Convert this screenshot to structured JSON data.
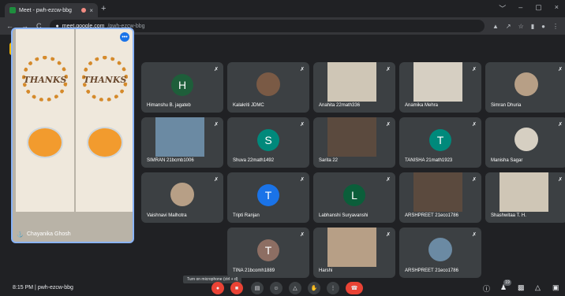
{
  "browser": {
    "tab_title": "Meet - pwh-ezcw-bbg",
    "tab_close": "×",
    "new_tab": "+",
    "url_host": "meet.google.com",
    "url_path": "/pwh-ezcw-bbg",
    "nav_back": "←",
    "nav_forward": "→",
    "nav_reload": "C",
    "win_min": "﹀",
    "win_minimize": "–",
    "win_restore": "▢",
    "win_close": "×"
  },
  "main_tile": {
    "name": "Chayanika Ghosh",
    "bag_text_left": "THANKS",
    "bag_text_right": "THANKS",
    "more": "•••"
  },
  "tiles": [
    {
      "name": "Himanshu B. jagateb",
      "initial": "H",
      "color": "#1e5e3a",
      "kind": "avatar"
    },
    {
      "name": "Kalakriti JDMC",
      "initial": "",
      "color": "#7a5a45",
      "kind": "pic"
    },
    {
      "name": "Anahita 22math336",
      "kind": "video"
    },
    {
      "name": "Anamika Mehra",
      "kind": "video"
    },
    {
      "name": "Simran Dhuria",
      "kind": "pic"
    },
    {
      "name": "SIMRAN 21bcmb1006",
      "kind": "video"
    },
    {
      "name": "Shuva 22math1492",
      "initial": "S",
      "color": "#00897b",
      "kind": "avatar"
    },
    {
      "name": "Sarita 22",
      "kind": "video"
    },
    {
      "name": "TANISHA 21math1923",
      "initial": "T",
      "color": "#00897b",
      "kind": "avatar"
    },
    {
      "name": "Manisha Sagar",
      "kind": "pic"
    },
    {
      "name": "Vaishnavi Malhotra",
      "kind": "pic"
    },
    {
      "name": "Tripti Ranjan",
      "initial": "T",
      "color": "#1a73e8",
      "kind": "avatar"
    },
    {
      "name": "Labhanshi Suryavanshi",
      "initial": "L",
      "color": "#0b5e3a",
      "kind": "avatar"
    },
    {
      "name": "ARSHPREET 21eco1786",
      "kind": "video"
    },
    {
      "name": "Shashwitaa T. H.",
      "kind": "video"
    },
    {
      "name": "TINA 21bcomh1889",
      "initial": "T",
      "color": "#8d6e63",
      "kind": "avatar"
    },
    {
      "name": "Harshi",
      "kind": "video"
    },
    {
      "name": "ARSHPREET 21eco1786",
      "kind": "pic"
    }
  ],
  "tooltip": "Turn on microphone (ctrl + d)",
  "footer": {
    "time": "8:15 PM",
    "separator": "|",
    "meeting_code": "pwh-ezcw-bbg",
    "participant_count": "19"
  },
  "icons": {
    "mic_off": "mic-off-icon",
    "tile_mic": "✗",
    "pin": "📌"
  }
}
